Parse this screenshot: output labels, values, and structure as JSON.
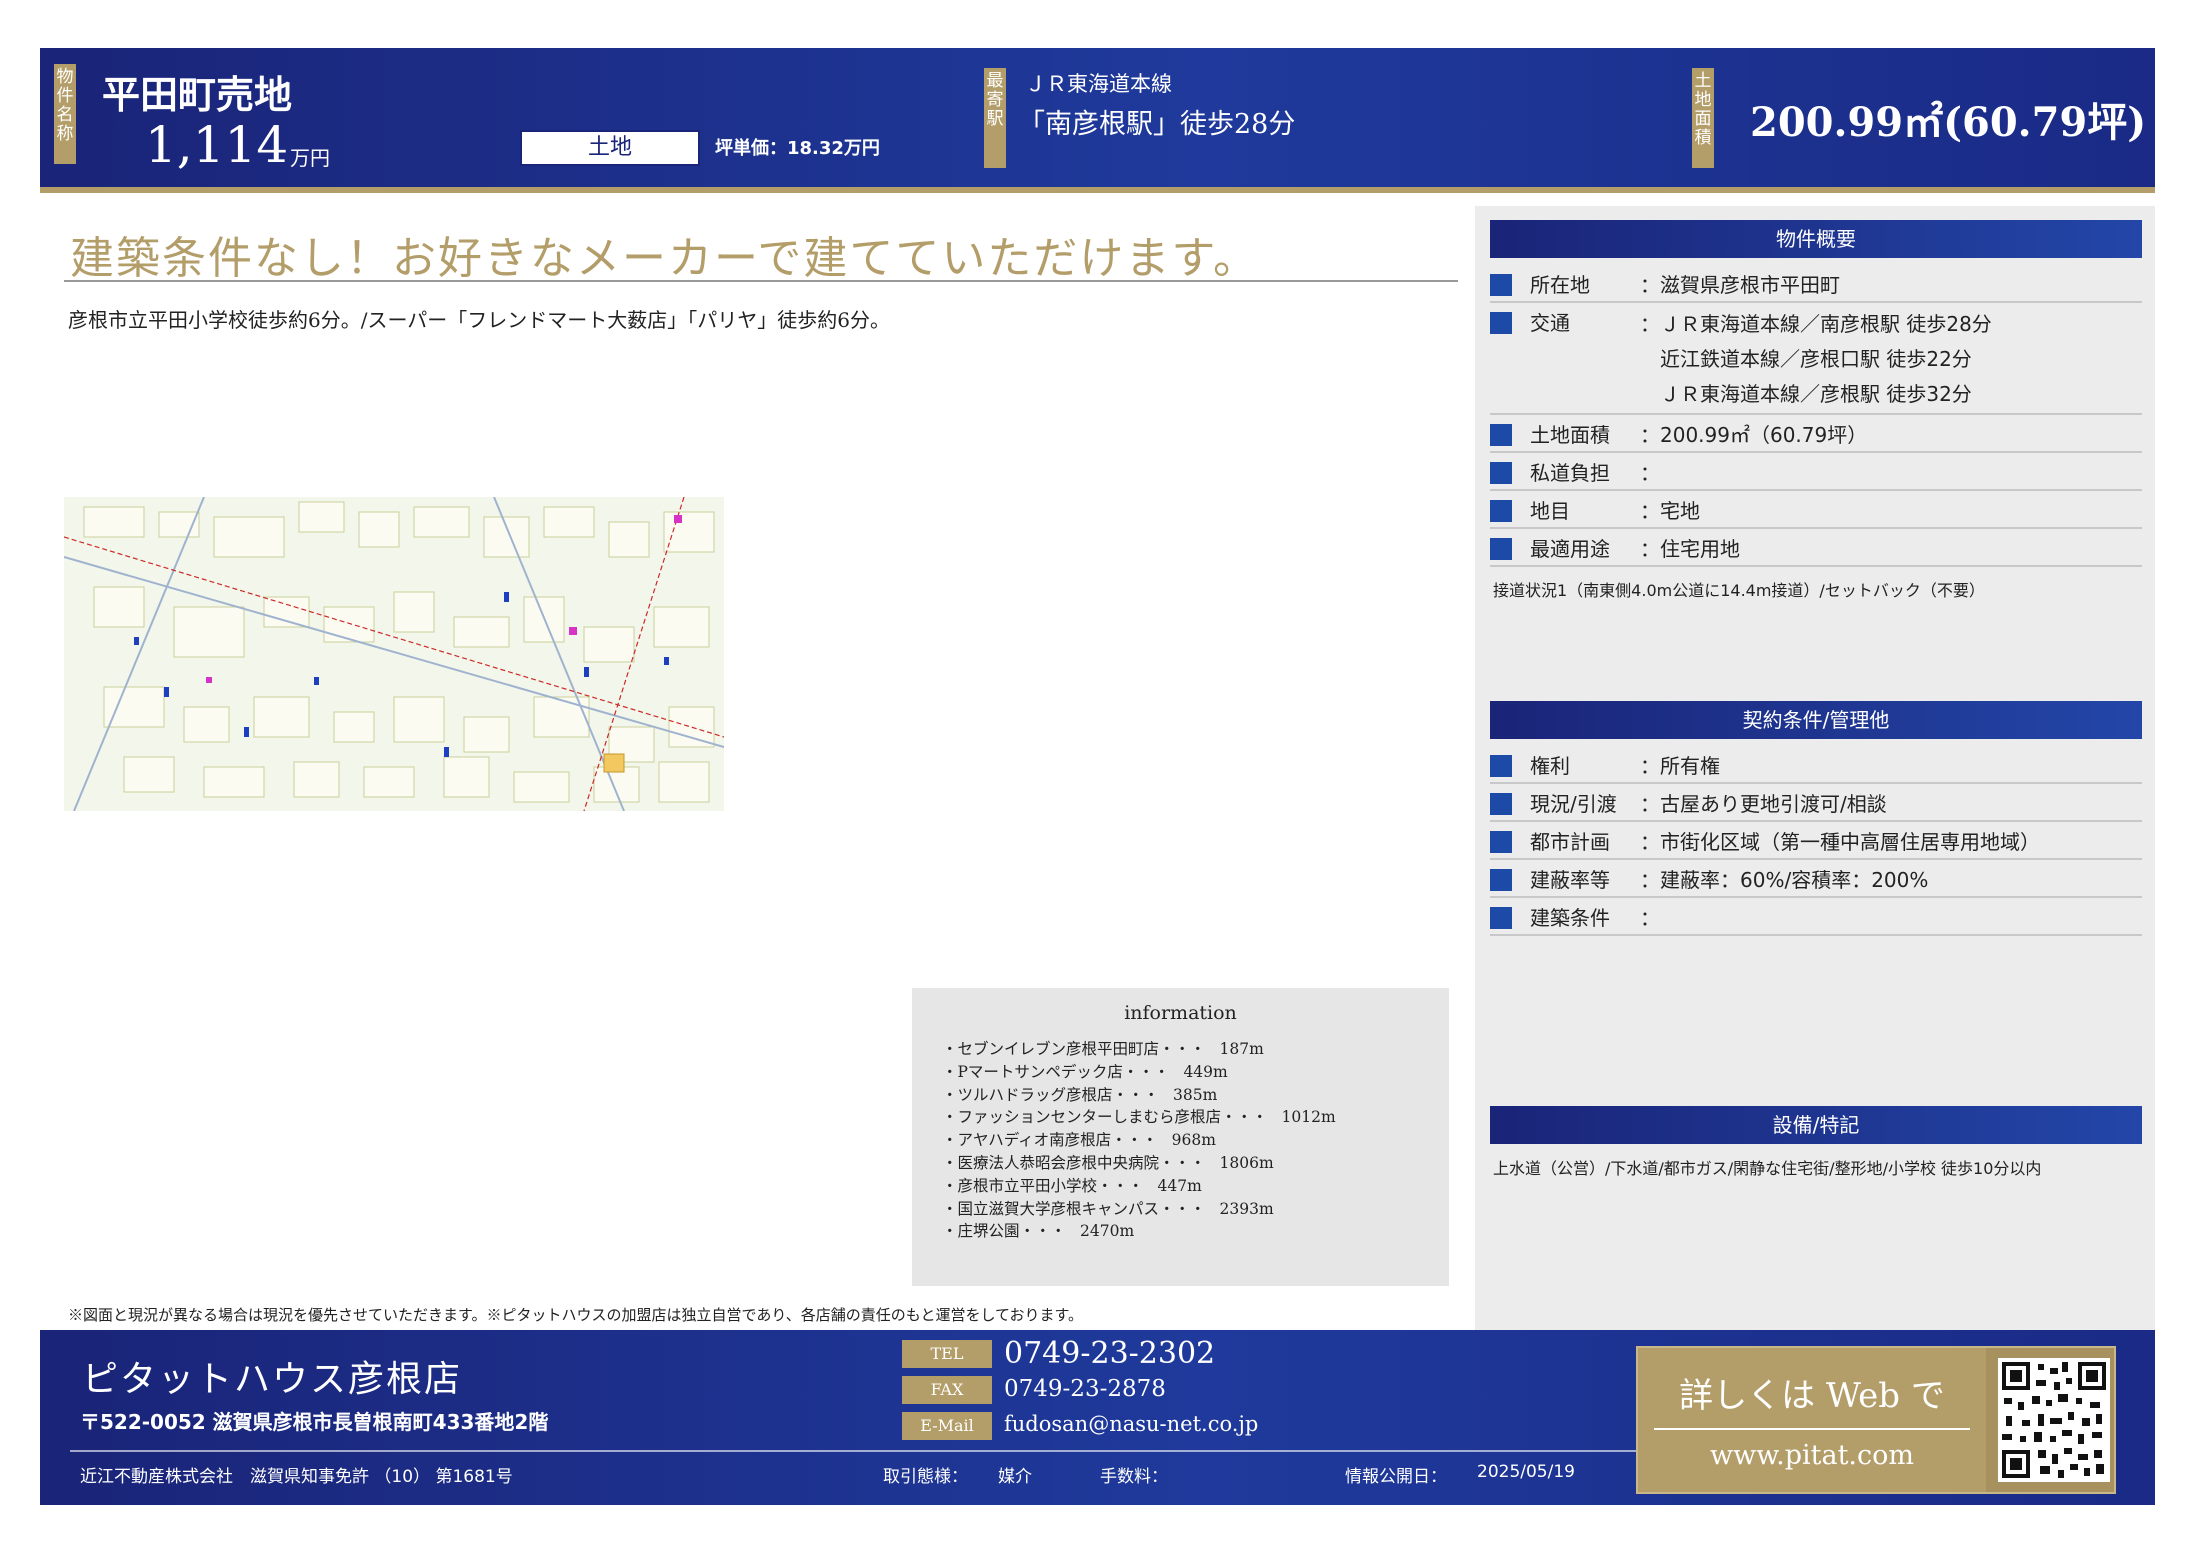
{
  "header": {
    "tag_property_name": "物件名称",
    "property_name": "平田町売地",
    "price": "1,114",
    "price_unit": "万円",
    "type": "土地",
    "unit_price": "坪単価：18.32万円",
    "tag_station": "最寄駅",
    "line": "ＪＲ東海道本線",
    "station_walk": "「南彦根駅」徒歩28分",
    "tag_area": "土地面積",
    "area": "200.99㎡(60.79坪)"
  },
  "main": {
    "headline": "建築条件なし！お好きなメーカーで建てていただけます。",
    "subtext": "彦根市立平田小学校徒歩約6分。/スーパー「フレンドマート大薮店」「パリヤ」徒歩約6分。"
  },
  "info": {
    "title": "information",
    "items": [
      {
        "name": "・セブンイレブン彦根平田町店・・・",
        "dist": "187m"
      },
      {
        "name": "・Pマートサンペデック店・・・",
        "dist": "449m"
      },
      {
        "name": "・ツルハドラッグ彦根店・・・",
        "dist": "385m"
      },
      {
        "name": "・ファッションセンターしまむら彦根店・・・",
        "dist": "1012m"
      },
      {
        "name": "・アヤハディオ南彦根店・・・",
        "dist": "968m"
      },
      {
        "name": "・医療法人恭昭会彦根中央病院・・・",
        "dist": "1806m"
      },
      {
        "name": "・彦根市立平田小学校・・・",
        "dist": "447m"
      },
      {
        "name": "・国立滋賀大学彦根キャンパス・・・",
        "dist": "2393m"
      },
      {
        "name": "・庄堺公園・・・",
        "dist": "2470m"
      }
    ]
  },
  "disclaimer": "※図面と現況が異なる場合は現況を優先させていただきます。※ピタットハウスの加盟店は独立自営であり、各店舗の責任のもと運営をしております。",
  "overview": {
    "title": "物件概要",
    "rows": [
      {
        "label": "所在地",
        "value": "：滋賀県彦根市平田町"
      },
      {
        "label": "交通",
        "lines": [
          "：ＪＲ東海道本線／南彦根駅 徒歩28分",
          "　近江鉄道本線／彦根口駅 徒歩22分",
          "　ＪＲ東海道本線／彦根駅 徒歩32分"
        ]
      },
      {
        "label": "土地面積",
        "value": "：200.99㎡（60.79坪）"
      },
      {
        "label": "私道負担",
        "value": "："
      },
      {
        "label": "地目",
        "value": "：宅地"
      },
      {
        "label": "最適用途",
        "value": "：住宅用地"
      }
    ],
    "note": "接道状況1（南東側4.0m公道に14.4m接道）/セットバック（不要）"
  },
  "contract": {
    "title": "契約条件/管理他",
    "rows": [
      {
        "label": "権利",
        "value": "：所有権"
      },
      {
        "label": "現況/引渡",
        "value": "：古屋あり更地引渡可/相談"
      },
      {
        "label": "都市計画",
        "value": "：市街化区域（第一種中高層住居専用地域）"
      },
      {
        "label": "建蔽率等",
        "value": "：建蔽率：60%/容積率：200%"
      },
      {
        "label": "建築条件",
        "value": "："
      }
    ]
  },
  "facilities": {
    "title": "設備/特記",
    "text": "上水道（公営）/下水道/都市ガス/閑静な住宅街/整形地/小学校 徒歩10分以内"
  },
  "footer": {
    "shop_name": "ピタットハウス彦根店",
    "address": "〒522-0052 滋賀県彦根市長曽根南町433番地2階",
    "tel_label": "TEL",
    "tel": "0749-23-2302",
    "fax_label": "FAX",
    "fax": "0749-23-2878",
    "mail_label": "E-Mail",
    "mail": "fudosan@nasu-net.co.jp",
    "company": "近江不動産株式会社　滋賀県知事免許 （10） 第1681号",
    "deal_label": "取引態様：",
    "deal": "媒介",
    "fee_label": "手数料：",
    "fee": "",
    "pub_label": "情報公開日：",
    "pub_date": "2025/05/19",
    "web_text": "詳しくは Web で",
    "web_url": "www.pitat.com"
  }
}
